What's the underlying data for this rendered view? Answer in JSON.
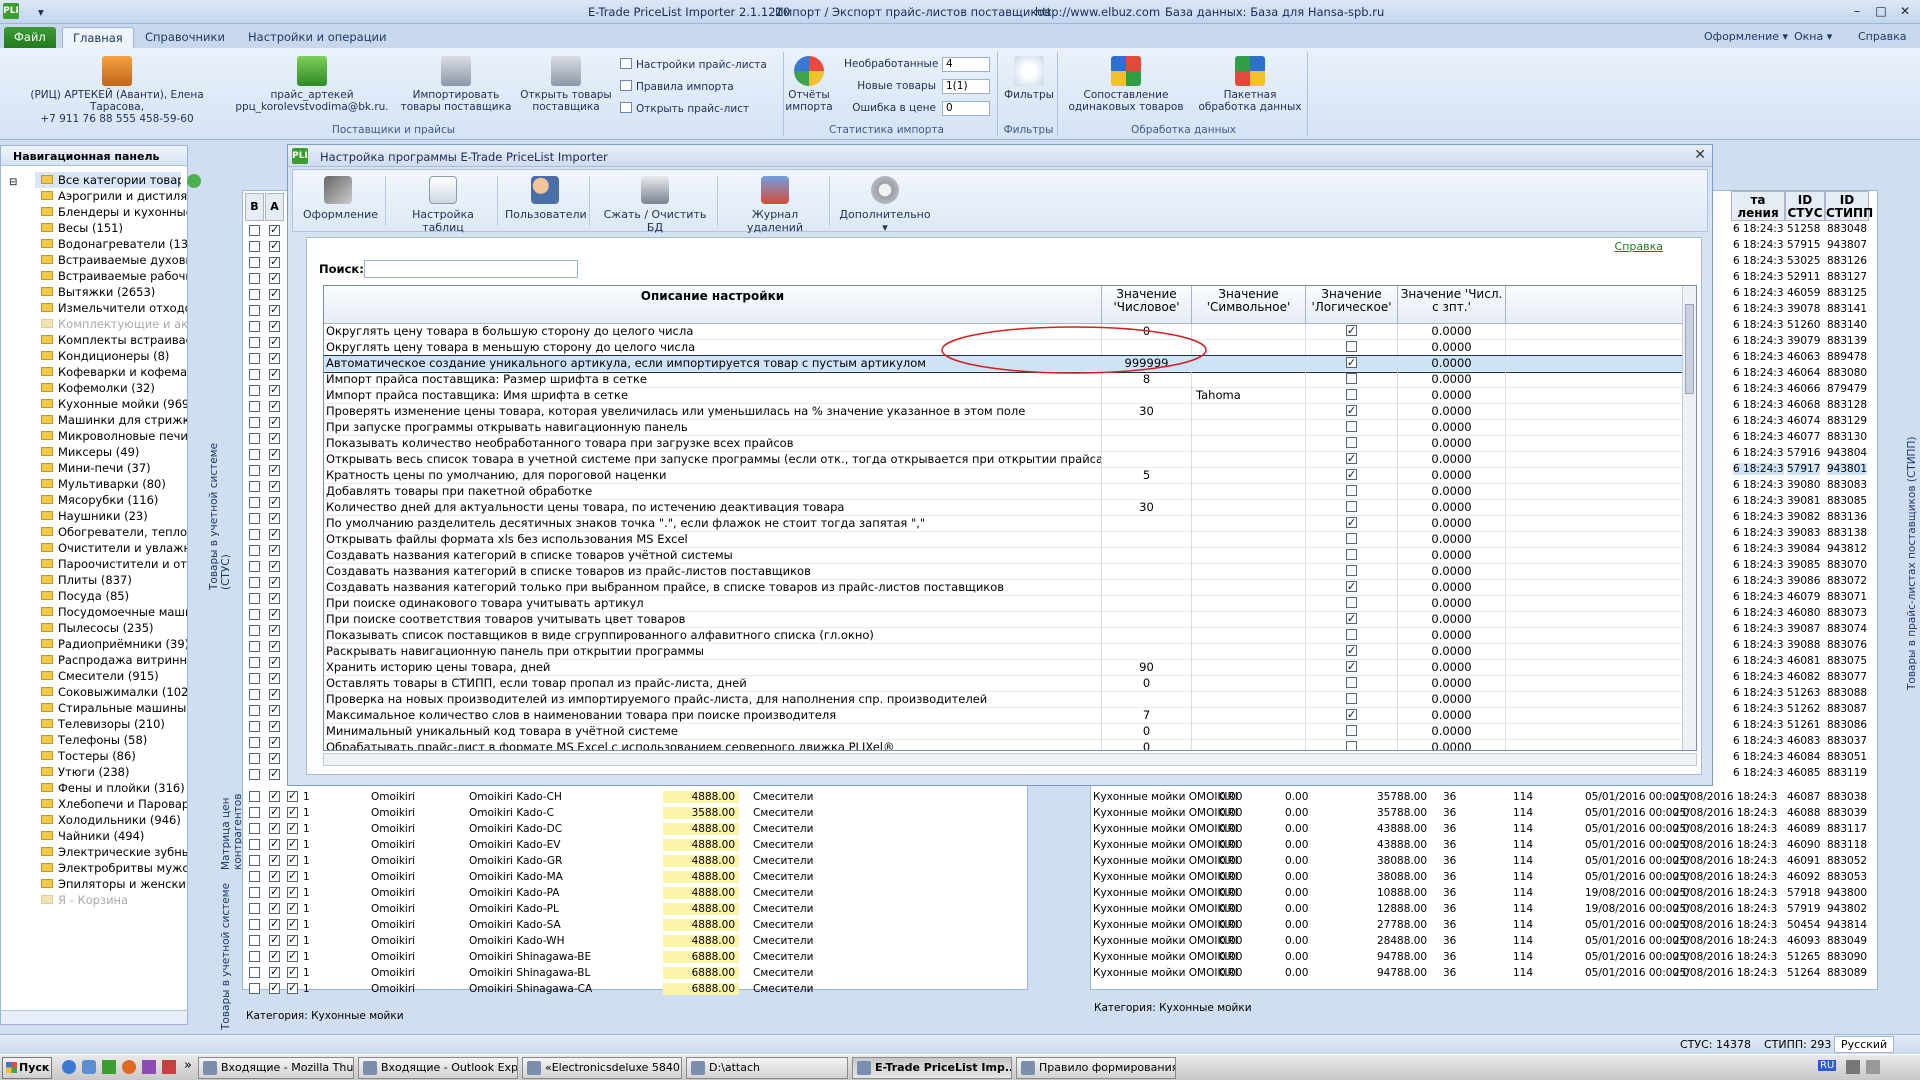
{
  "window": {
    "app_title": "E-Trade PriceList Importer 2.1.1210",
    "subtitle": "Импорт / Экспорт прайс-листов поставщиков",
    "url": "http://www.elbuz.com",
    "db": "База данных: База для Hansa-spb.ru",
    "app_icon": "PLI",
    "right_menu": [
      "Оформление",
      "Окна",
      "Справка"
    ]
  },
  "ribbon": {
    "tabs": [
      "Файл",
      "Главная",
      "Справочники",
      "Настройки и операции"
    ],
    "supplier_line1": "(РИЦ) АРТЕКЕЙ (Аванти), Елена Тарасова,",
    "supplier_line2": "+7 911 76 88 555   458-59-60",
    "pricelist_line1": "прайс_артекей",
    "pricelist_line2": "ррц_korolevstvodima@bk.ru.",
    "import_goods": "Импортировать товары поставщика",
    "open_goods": "Открыть товары поставщика",
    "small_buttons": [
      "Настройки прайс-листа",
      "Правила импорта",
      "Открыть прайс-лист"
    ],
    "group_suppliers": "Поставщики и прайсы",
    "reports": "Отчёты импорта",
    "stat_labels": [
      "Необработанные",
      "Новые товары",
      "Ошибка в цене"
    ],
    "stat_values": [
      "4",
      "1(1)",
      "0"
    ],
    "group_stats": "Статистика импорта",
    "filters": "Фильтры",
    "group_filters": "Фильтры",
    "compare": "Сопоставление одинаковых товаров",
    "batch": "Пакетная обработка данных",
    "group_processing": "Обработка данных"
  },
  "nav": {
    "title": "Навигационная панель",
    "items": [
      {
        "label": "Все категории товаров",
        "disabled": false
      },
      {
        "label": "Аэрогрили и дистиля",
        "disabled": false
      },
      {
        "label": "Блендеры и кухонные",
        "disabled": false
      },
      {
        "label": "Весы (151)",
        "disabled": false
      },
      {
        "label": "Водонагреватели (13",
        "disabled": false
      },
      {
        "label": "Встраиваемые духовы",
        "disabled": false
      },
      {
        "label": "Встраиваемые рабочи",
        "disabled": false
      },
      {
        "label": "Вытяжки (2653)",
        "disabled": false
      },
      {
        "label": "Измельчители отходо",
        "disabled": false
      },
      {
        "label": "Комплектующие и акс",
        "disabled": true
      },
      {
        "label": "Комплекты встраивае",
        "disabled": false
      },
      {
        "label": "Кондиционеры (8)",
        "disabled": false
      },
      {
        "label": "Кофеварки и кофема",
        "disabled": false
      },
      {
        "label": "Кофемолки (32)",
        "disabled": false
      },
      {
        "label": "Кухонные мойки (969",
        "disabled": false
      },
      {
        "label": "Машинки для стрижки",
        "disabled": false
      },
      {
        "label": "Микроволновые печи",
        "disabled": false
      },
      {
        "label": "Миксеры (49)",
        "disabled": false
      },
      {
        "label": "Мини-печи (37)",
        "disabled": false
      },
      {
        "label": "Мультиварки (80)",
        "disabled": false
      },
      {
        "label": "Мясорубки (116)",
        "disabled": false
      },
      {
        "label": "Наушники (23)",
        "disabled": false
      },
      {
        "label": "Обогреватели, тепло",
        "disabled": false
      },
      {
        "label": "Очистители и увлажн",
        "disabled": false
      },
      {
        "label": "Пароочистители и от",
        "disabled": false
      },
      {
        "label": "Плиты (837)",
        "disabled": false
      },
      {
        "label": "Посуда (85)",
        "disabled": false
      },
      {
        "label": "Посудомоечные маши",
        "disabled": false
      },
      {
        "label": "Пылесосы (235)",
        "disabled": false
      },
      {
        "label": "Радиоприёмники (39)",
        "disabled": false
      },
      {
        "label": "Распродажа витринн",
        "disabled": false
      },
      {
        "label": "Смесители (915)",
        "disabled": false
      },
      {
        "label": "Соковыжималки (102",
        "disabled": false
      },
      {
        "label": "Стиральные машины (",
        "disabled": false
      },
      {
        "label": "Телевизоры (210)",
        "disabled": false
      },
      {
        "label": "Телефоны (58)",
        "disabled": false
      },
      {
        "label": "Тостеры (86)",
        "disabled": false
      },
      {
        "label": "Утюги (238)",
        "disabled": false
      },
      {
        "label": "Фены и плойки (316)",
        "disabled": false
      },
      {
        "label": "Хлебопечи и Пароварк",
        "disabled": false
      },
      {
        "label": "Холодильники (946)",
        "disabled": false
      },
      {
        "label": "Чайники (494)",
        "disabled": false
      },
      {
        "label": "Электрические зубны",
        "disabled": false
      },
      {
        "label": "Электробритвы мужс",
        "disabled": false
      },
      {
        "label": "Эпиляторы и женски",
        "disabled": false
      },
      {
        "label": "Я - Корзина",
        "disabled": true
      }
    ]
  },
  "side_tabs": {
    "left_top": "Товары в учетной системе (СТУС)",
    "left_mid": "Матрица цен контрагентов",
    "left_bottom": "Товары в учетной системе",
    "right": "Товары в прайс-листах поставщиков (СТИПП)"
  },
  "left_grid": {
    "headers": [
      "В",
      "А"
    ],
    "rows": [
      [
        "1",
        "Omoikiri",
        "Omoikiri Kado-CH",
        "4888.00",
        "Смесители"
      ],
      [
        "1",
        "Omoikiri",
        "Omoikiri Kado-C",
        "3588.00",
        "Смесители"
      ],
      [
        "1",
        "Omoikiri",
        "Omoikiri Kado-DC",
        "4888.00",
        "Смесители"
      ],
      [
        "1",
        "Omoikiri",
        "Omoikiri Kado-EV",
        "4888.00",
        "Смесители"
      ],
      [
        "1",
        "Omoikiri",
        "Omoikiri Kado-GR",
        "4888.00",
        "Смесители"
      ],
      [
        "1",
        "Omoikiri",
        "Omoikiri Kado-MA",
        "4888.00",
        "Смесители"
      ],
      [
        "1",
        "Omoikiri",
        "Omoikiri Kado-PA",
        "4888.00",
        "Смесители"
      ],
      [
        "1",
        "Omoikiri",
        "Omoikiri Kado-PL",
        "4888.00",
        "Смесители"
      ],
      [
        "1",
        "Omoikiri",
        "Omoikiri Kado-SA",
        "4888.00",
        "Смесители"
      ],
      [
        "1",
        "Omoikiri",
        "Omoikiri Kado-WH",
        "4888.00",
        "Смесители"
      ],
      [
        "1",
        "Omoikiri",
        "Omoikiri Shinagawa-BE",
        "6888.00",
        "Смесители"
      ],
      [
        "1",
        "Omoikiri",
        "Omoikiri Shinagawa-BL",
        "6888.00",
        "Смесители"
      ],
      [
        "1",
        "Omoikiri",
        "Omoikiri Shinagawa-CA",
        "6888.00",
        "Смесители"
      ]
    ],
    "category": "Категория: Кухонные мойки"
  },
  "right_grid": {
    "headers": [
      "та ления",
      "ID СТУС",
      "ID СТИПП"
    ],
    "top_rows": [
      [
        "6 18:24:3",
        "51258",
        "883048"
      ],
      [
        "6 18:24:3",
        "57915",
        "943807"
      ],
      [
        "6 18:24:3",
        "53025",
        "883126"
      ],
      [
        "6 18:24:3",
        "52911",
        "883127"
      ],
      [
        "6 18:24:3",
        "46059",
        "883125"
      ],
      [
        "6 18:24:3",
        "39078",
        "883141"
      ],
      [
        "6 18:24:3",
        "51260",
        "883140"
      ],
      [
        "6 18:24:3",
        "39079",
        "883139"
      ],
      [
        "6 18:24:3",
        "46063",
        "889478"
      ],
      [
        "6 18:24:3",
        "46064",
        "883080"
      ],
      [
        "6 18:24:3",
        "46066",
        "879479"
      ],
      [
        "6 18:24:3",
        "46068",
        "883128"
      ],
      [
        "6 18:24:3",
        "46074",
        "883129"
      ],
      [
        "6 18:24:3",
        "46077",
        "883130"
      ],
      [
        "6 18:24:3",
        "57916",
        "943804"
      ],
      [
        "6 18:24:3",
        "57917",
        "943801"
      ],
      [
        "6 18:24:3",
        "39080",
        "883083"
      ],
      [
        "6 18:24:3",
        "39081",
        "883085"
      ],
      [
        "6 18:24:3",
        "39082",
        "883136"
      ],
      [
        "6 18:24:3",
        "39083",
        "883138"
      ],
      [
        "6 18:24:3",
        "39084",
        "943812"
      ],
      [
        "6 18:24:3",
        "39085",
        "883070"
      ],
      [
        "6 18:24:3",
        "39086",
        "883072"
      ],
      [
        "6 18:24:3",
        "46079",
        "883071"
      ],
      [
        "6 18:24:3",
        "46080",
        "883073"
      ],
      [
        "6 18:24:3",
        "39087",
        "883074"
      ],
      [
        "6 18:24:3",
        "39088",
        "883076"
      ],
      [
        "6 18:24:3",
        "46081",
        "883075"
      ],
      [
        "6 18:24:3",
        "46082",
        "883077"
      ],
      [
        "6 18:24:3",
        "51263",
        "883088"
      ],
      [
        "6 18:24:3",
        "51262",
        "883087"
      ],
      [
        "6 18:24:3",
        "51261",
        "883086"
      ],
      [
        "6 18:24:3",
        "46083",
        "883037"
      ],
      [
        "6 18:24:3",
        "46084",
        "883051"
      ],
      [
        "6 18:24:3",
        "46085",
        "883119"
      ]
    ],
    "bottom_rows": [
      [
        "Кухонные мойки OMOIKIRI",
        "0.00",
        "0.00",
        "35788.00",
        "36",
        "114",
        "05/01/2016 00:00:0",
        "25/08/2016 18:24:3",
        "46087",
        "883038"
      ],
      [
        "Кухонные мойки OMOIKIRI",
        "0.00",
        "0.00",
        "35788.00",
        "36",
        "114",
        "05/01/2016 00:00:0",
        "25/08/2016 18:24:3",
        "46088",
        "883039"
      ],
      [
        "Кухонные мойки OMOIKIRI",
        "0.00",
        "0.00",
        "43888.00",
        "36",
        "114",
        "05/01/2016 00:00:0",
        "25/08/2016 18:24:3",
        "46089",
        "883117"
      ],
      [
        "Кухонные мойки OMOIKIRI",
        "0.00",
        "0.00",
        "43888.00",
        "36",
        "114",
        "05/01/2016 00:00:0",
        "25/08/2016 18:24:3",
        "46090",
        "883118"
      ],
      [
        "Кухонные мойки OMOIKIRI",
        "0.00",
        "0.00",
        "38088.00",
        "36",
        "114",
        "05/01/2016 00:00:0",
        "25/08/2016 18:24:3",
        "46091",
        "883052"
      ],
      [
        "Кухонные мойки OMOIKIRI",
        "0.00",
        "0.00",
        "38088.00",
        "36",
        "114",
        "05/01/2016 00:00:0",
        "25/08/2016 18:24:3",
        "46092",
        "883053"
      ],
      [
        "Кухонные мойки OMOIKIRI",
        "0.00",
        "0.00",
        "10888.00",
        "36",
        "114",
        "19/08/2016 00:00:0",
        "25/08/2016 18:24:3",
        "57918",
        "943800"
      ],
      [
        "Кухонные мойки OMOIKIRI",
        "0.00",
        "0.00",
        "12888.00",
        "36",
        "114",
        "19/08/2016 00:00:0",
        "25/08/2016 18:24:3",
        "57919",
        "943802"
      ],
      [
        "Кухонные мойки OMOIKIRI",
        "0.00",
        "0.00",
        "27788.00",
        "36",
        "114",
        "05/01/2016 00:00:0",
        "25/08/2016 18:24:3",
        "50454",
        "943814"
      ],
      [
        "Кухонные мойки OMOIKIRI",
        "0.00",
        "0.00",
        "28488.00",
        "36",
        "114",
        "05/01/2016 00:00:0",
        "25/08/2016 18:24:3",
        "46093",
        "883049"
      ],
      [
        "Кухонные мойки OMOIKIRI",
        "0.00",
        "0.00",
        "94788.00",
        "36",
        "114",
        "05/01/2016 00:00:0",
        "25/08/2016 18:24:3",
        "51265",
        "883090"
      ],
      [
        "Кухонные мойки OMOIKIRI",
        "0.00",
        "0.00",
        "94788.00",
        "36",
        "114",
        "05/01/2016 00:00:0",
        "25/08/2016 18:24:3",
        "51264",
        "883089"
      ]
    ],
    "category": "Категория: Кухонные мойки"
  },
  "dialog": {
    "title": "Настройка программы E-Trade PriceList Importer",
    "toolbar": [
      "Оформление",
      "Настройка таблиц",
      "Пользователи",
      "Сжать / Очистить БД",
      "Журнал удалений",
      "Дополнительно"
    ],
    "help_link": "Справка",
    "search_label": "Поиск:",
    "search_value": "",
    "columns": [
      "Описание настройки",
      "Значение 'Числовое'",
      "Значение 'Символьное'",
      "Значение 'Логическое'",
      "Значение 'Числ. с зпт.'"
    ],
    "rows": [
      {
        "desc": "Округлять цену товара в большую сторону до целого числа",
        "num": "0",
        "sym": "",
        "bool": true,
        "dec": "0.0000"
      },
      {
        "desc": "Округлять цену товара в меньшую сторону до целого числа",
        "num": "",
        "sym": "",
        "bool": false,
        "dec": "0.0000"
      },
      {
        "desc": "Автоматическое создание уникального артикула, если импортируется товар с пустым артикулом",
        "num": "999999",
        "sym": "",
        "bool": true,
        "dec": "0.0000"
      },
      {
        "desc": "Импорт прайса поставщика: Размер шрифта в сетке",
        "num": "8",
        "sym": "",
        "bool": false,
        "dec": "0.0000"
      },
      {
        "desc": "Импорт прайса поставщика: Имя шрифта в сетке",
        "num": "",
        "sym": "Tahoma",
        "bool": false,
        "dec": "0.0000"
      },
      {
        "desc": "Проверять изменение цены товара, которая увеличилась или уменьшилась на % значение указанное в этом поле",
        "num": "30",
        "sym": "",
        "bool": true,
        "dec": "0.0000"
      },
      {
        "desc": "При запуске программы открывать навигационную панель",
        "num": "",
        "sym": "",
        "bool": false,
        "dec": "0.0000"
      },
      {
        "desc": "Показывать количество необработанного товара при загрузке всех прайсов",
        "num": "",
        "sym": "",
        "bool": false,
        "dec": "0.0000"
      },
      {
        "desc": "Открывать весь список товара в учетной системе при запуске программы (если отк., тогда открывается при открытии прайса)",
        "num": "",
        "sym": "",
        "bool": true,
        "dec": "0.0000"
      },
      {
        "desc": "Кратность цены по умолчанию, для пороговой наценки",
        "num": "5",
        "sym": "",
        "bool": true,
        "dec": "0.0000"
      },
      {
        "desc": "Добавлять товары при пакетной обработке",
        "num": "",
        "sym": "",
        "bool": false,
        "dec": "0.0000"
      },
      {
        "desc": "Количество дней для актуальности цены товара, по истечению деактивация товара",
        "num": "30",
        "sym": "",
        "bool": false,
        "dec": "0.0000"
      },
      {
        "desc": "По умолчанию разделитель десятичных знаков точка \".\", если флажок не стоит тогда запятая \",\"",
        "num": "",
        "sym": "",
        "bool": true,
        "dec": "0.0000"
      },
      {
        "desc": "Открывать файлы формата xls без использования MS Excel",
        "num": "",
        "sym": "",
        "bool": false,
        "dec": "0.0000"
      },
      {
        "desc": "Создавать названия категорий в списке товаров учётной системы",
        "num": "",
        "sym": "",
        "bool": false,
        "dec": "0.0000"
      },
      {
        "desc": "Создавать названия категорий в списке товаров из прайс-листов поставщиков",
        "num": "",
        "sym": "",
        "bool": false,
        "dec": "0.0000"
      },
      {
        "desc": "Создавать названия категорий только при выбранном прайсе, в списке товаров из прайс-листов поставщиков",
        "num": "",
        "sym": "",
        "bool": true,
        "dec": "0.0000"
      },
      {
        "desc": "При поиске одинакового товара учитывать артикул",
        "num": "",
        "sym": "",
        "bool": false,
        "dec": "0.0000"
      },
      {
        "desc": "При поиске соответствия товаров учитывать цвет товаров",
        "num": "",
        "sym": "",
        "bool": true,
        "dec": "0.0000"
      },
      {
        "desc": "Показывать список поставщиков в виде сгруппированного алфавитного списка (гл.окно)",
        "num": "",
        "sym": "",
        "bool": false,
        "dec": "0.0000"
      },
      {
        "desc": "Раскрывать навигационную панель при открытии программы",
        "num": "",
        "sym": "",
        "bool": true,
        "dec": "0.0000"
      },
      {
        "desc": "Хранить историю цены товара, дней",
        "num": "90",
        "sym": "",
        "bool": true,
        "dec": "0.0000"
      },
      {
        "desc": "Оставлять товары в СТИПП, если товар пропал из прайс-листа, дней",
        "num": "0",
        "sym": "",
        "bool": false,
        "dec": "0.0000"
      },
      {
        "desc": "Проверка на новых производителей из импортируемого прайс-листа, для наполнения спр. производителей",
        "num": "",
        "sym": "",
        "bool": false,
        "dec": "0.0000"
      },
      {
        "desc": "Максимальное количество слов в наименовании товара при поиске производителя",
        "num": "7",
        "sym": "",
        "bool": true,
        "dec": "0.0000"
      },
      {
        "desc": "Минимальный уникальный код товара в учётной системе",
        "num": "0",
        "sym": "",
        "bool": false,
        "dec": "0.0000"
      },
      {
        "desc": "Обрабатывать прайс-лист в формате MS Excel с использованием серверного движка PLIXel®",
        "num": "0",
        "sym": "",
        "bool": false,
        "dec": "0.0000"
      }
    ]
  },
  "statusbar": {
    "stus": "СТУС: 14378",
    "stipp": "СТИПП: 293",
    "lang": "Русский"
  },
  "taskbar": {
    "start": "Пуск",
    "tasks": [
      "Входящие - Mozilla Thun...",
      "Входящие - Outlook Exp...",
      "«Electronicsdeluxe 5840....",
      "D:\\attach",
      "E-Trade PriceList Imp...",
      "Правило формирования..."
    ],
    "tray_lang": "RU",
    "time": ""
  },
  "colors": {
    "accent": "#3a9d2e",
    "highlight_ring": "#d32020",
    "selected_row": "#cfe3f7"
  }
}
